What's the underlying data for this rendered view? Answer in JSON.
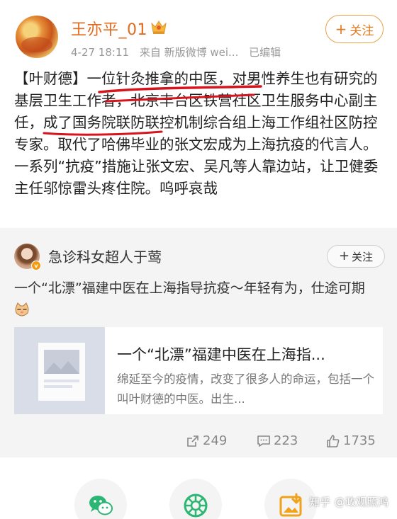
{
  "post": {
    "user_name": "王亦平_01",
    "date": "4-27 18:11",
    "source": "来自 新版微博 wei...",
    "edited": "已编辑",
    "follow_label": "关注",
    "text": "【叶财德】一位针灸推拿的中医，对男性养生也有研究的基层卫生工作者，北京丰台区铁营社区卫生服务中心副主任，成了国务院联防联控机制综合组上海工作组社区防控专家。取代了哈佛毕业的张文宏成为上海抗疫的代言人。一系列“抗疫”措施让张文宏、吴凡等人靠边站，让卫健委主任邬惊雷头疼住院。呜呼哀哉",
    "annotation_color": "#d7141c",
    "accent_color": "#e36b1f"
  },
  "repost": {
    "user_name": "急诊科女超人于莺",
    "verified_badge": "v",
    "follow_label": "关注",
    "text": "一个“北漂”福建中医在上海指导抗疫～年轻有为，仕途可期",
    "link": {
      "title": "一个“北漂”福建中医在上海指...",
      "description": "绵延至今的疫情，改变了很多人的命运，包括一个叫叶财德的中医。出生..."
    },
    "stats": {
      "reposts": "249",
      "comments": "223",
      "likes": "1735"
    }
  },
  "share": {
    "icons": [
      "wechat-icon",
      "moments-icon",
      "save-image-icon"
    ],
    "watermark": "知乎 @政观照鸿"
  }
}
